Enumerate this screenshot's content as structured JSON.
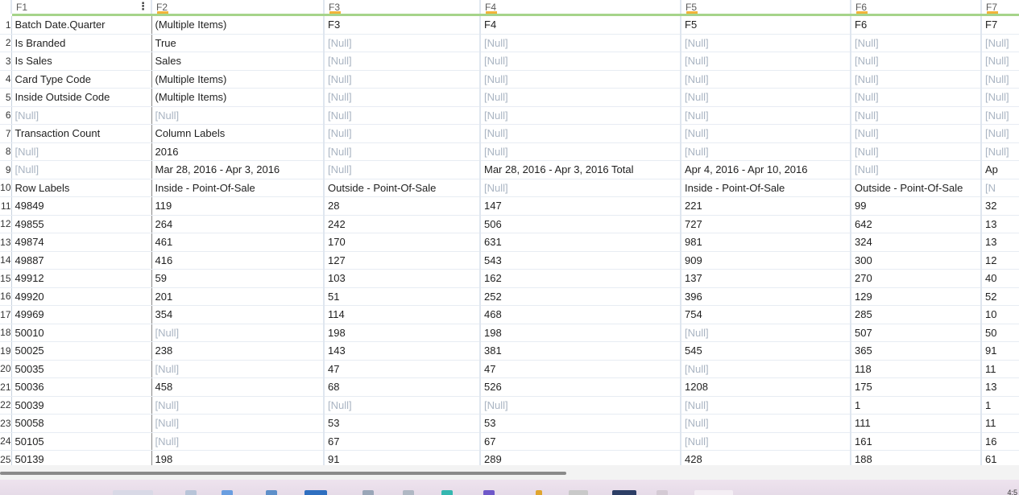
{
  "grid": {
    "columns": [
      "F1",
      "F2",
      "F3",
      "F4",
      "F5",
      "F6",
      "F7"
    ],
    "rows": [
      {
        "idx": "1",
        "cells": [
          "Batch Date.Quarter",
          "(Multiple Items)",
          "F3",
          "F4",
          "F5",
          "F6",
          "F7"
        ]
      },
      {
        "idx": "2",
        "cells": [
          "Is Branded",
          "True",
          "[Null]",
          "[Null]",
          "[Null]",
          "[Null]",
          "[Null]"
        ]
      },
      {
        "idx": "3",
        "cells": [
          "Is Sales",
          "Sales",
          "[Null]",
          "[Null]",
          "[Null]",
          "[Null]",
          "[Null]"
        ]
      },
      {
        "idx": "4",
        "cells": [
          "Card Type Code",
          "(Multiple Items)",
          "[Null]",
          "[Null]",
          "[Null]",
          "[Null]",
          "[Null]"
        ]
      },
      {
        "idx": "5",
        "cells": [
          "Inside Outside Code",
          "(Multiple Items)",
          "[Null]",
          "[Null]",
          "[Null]",
          "[Null]",
          "[Null]"
        ]
      },
      {
        "idx": "6",
        "cells": [
          "[Null]",
          "[Null]",
          "[Null]",
          "[Null]",
          "[Null]",
          "[Null]",
          "[Null]"
        ]
      },
      {
        "idx": "7",
        "cells": [
          "Transaction Count",
          "Column Labels",
          "[Null]",
          "[Null]",
          "[Null]",
          "[Null]",
          "[Null]"
        ]
      },
      {
        "idx": "8",
        "cells": [
          "[Null]",
          "2016",
          "[Null]",
          "[Null]",
          "[Null]",
          "[Null]",
          "[Null]"
        ]
      },
      {
        "idx": "9",
        "cells": [
          "[Null]",
          "Mar 28, 2016 - Apr 3, 2016",
          "[Null]",
          "Mar 28, 2016 - Apr 3, 2016 Total",
          "Apr 4, 2016 - Apr 10, 2016",
          "[Null]",
          "Ap"
        ]
      },
      {
        "idx": "10",
        "cells": [
          "Row Labels",
          "Inside - Point-Of-Sale",
          "Outside - Point-Of-Sale",
          "[Null]",
          "Inside - Point-Of-Sale",
          "Outside - Point-Of-Sale",
          "[N"
        ]
      },
      {
        "idx": "11",
        "cells": [
          "49849",
          "119",
          "28",
          "147",
          "221",
          "99",
          "32"
        ]
      },
      {
        "idx": "12",
        "cells": [
          "49855",
          "264",
          "242",
          "506",
          "727",
          "642",
          "13"
        ]
      },
      {
        "idx": "13",
        "cells": [
          "49874",
          "461",
          "170",
          "631",
          "981",
          "324",
          "13"
        ]
      },
      {
        "idx": "14",
        "cells": [
          "49887",
          "416",
          "127",
          "543",
          "909",
          "300",
          "12"
        ]
      },
      {
        "idx": "15",
        "cells": [
          "49912",
          "59",
          "103",
          "162",
          "137",
          "270",
          "40"
        ]
      },
      {
        "idx": "16",
        "cells": [
          "49920",
          "201",
          "51",
          "252",
          "396",
          "129",
          "52"
        ]
      },
      {
        "idx": "17",
        "cells": [
          "49969",
          "354",
          "114",
          "468",
          "754",
          "285",
          "10"
        ]
      },
      {
        "idx": "18",
        "cells": [
          "50010",
          "[Null]",
          "198",
          "198",
          "[Null]",
          "507",
          "50"
        ]
      },
      {
        "idx": "19",
        "cells": [
          "50025",
          "238",
          "143",
          "381",
          "545",
          "365",
          "91"
        ]
      },
      {
        "idx": "20",
        "cells": [
          "50035",
          "[Null]",
          "47",
          "47",
          "[Null]",
          "118",
          "11"
        ]
      },
      {
        "idx": "21",
        "cells": [
          "50036",
          "458",
          "68",
          "526",
          "1208",
          "175",
          "13"
        ]
      },
      {
        "idx": "22",
        "cells": [
          "50039",
          "[Null]",
          "[Null]",
          "[Null]",
          "[Null]",
          "1",
          "1"
        ]
      },
      {
        "idx": "23",
        "cells": [
          "50058",
          "[Null]",
          "53",
          "53",
          "[Null]",
          "111",
          "11"
        ]
      },
      {
        "idx": "24",
        "cells": [
          "50105",
          "[Null]",
          "67",
          "67",
          "[Null]",
          "161",
          "16"
        ]
      },
      {
        "idx": "25",
        "cells": [
          "50139",
          "198",
          "91",
          "289",
          "428",
          "188",
          "61"
        ]
      }
    ]
  },
  "colors": {
    "header_underline": "#a6d48a",
    "header_marker": "#f2b43a",
    "null_text": "#a9b4c2",
    "grid_line": "#dfe6ef"
  },
  "icons": {
    "column_menu": "kebab-menu-icon"
  },
  "taskbar": {
    "clock": "4:5"
  }
}
